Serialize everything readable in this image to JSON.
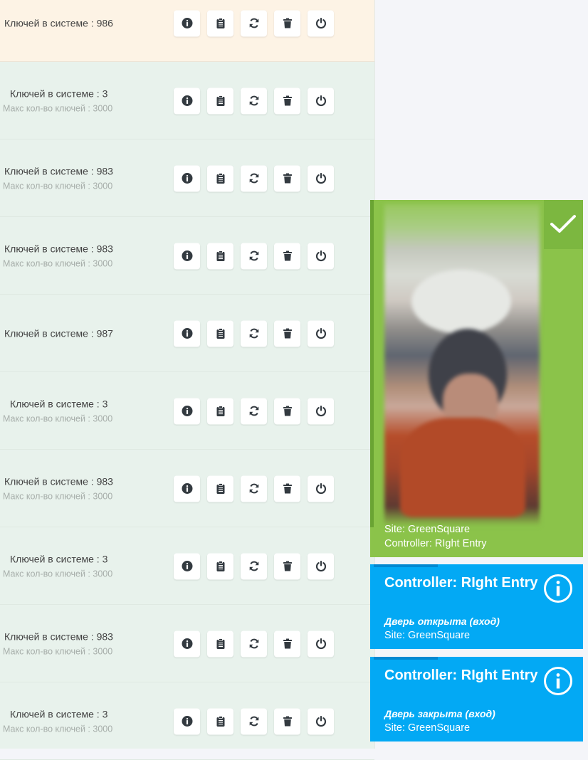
{
  "rows": [
    {
      "keys": "Ключей в системе : 986",
      "max": ""
    },
    {
      "keys": "Ключей в системе : 3",
      "max": "Макс кол-во ключей : 3000"
    },
    {
      "keys": "Ключей в системе : 983",
      "max": "Макс кол-во ключей : 3000"
    },
    {
      "keys": "Ключей в системе : 983",
      "max": "Макс кол-во ключей : 3000"
    },
    {
      "keys": "Ключей в системе : 987",
      "max": ""
    },
    {
      "keys": "Ключей в системе : 3",
      "max": "Макс кол-во ключей : 3000"
    },
    {
      "keys": "Ключей в системе : 983",
      "max": "Макс кол-во ключей : 3000"
    },
    {
      "keys": "Ключей в системе : 3",
      "max": "Макс кол-во ключей : 3000"
    },
    {
      "keys": "Ключей в системе : 983",
      "max": "Макс кол-во ключей : 3000"
    },
    {
      "keys": "Ключей в системе : 3",
      "max": "Макс кол-во ключей : 3000"
    }
  ],
  "row_buttons": [
    "info-icon",
    "clipboard-icon",
    "sync-icon",
    "trash-icon",
    "power-icon"
  ],
  "face_card": {
    "site": "Site: GreenSquare",
    "controller": "Controller: RIght Entry",
    "icon": "check-icon",
    "color": "#8bc34a"
  },
  "events": [
    {
      "title": "Controller: RIght Entry",
      "status": "Дверь открыта (вход)",
      "site": "Site: GreenSquare"
    },
    {
      "title": "Controller: RIght Entry",
      "status": "Дверь закрыта (вход)",
      "site": "Site: GreenSquare"
    }
  ],
  "colors": {
    "event": "#03a9f4",
    "accepted": "#8bc34a",
    "warning_row": "#fdf3e5",
    "row": "#e8f2ec"
  }
}
